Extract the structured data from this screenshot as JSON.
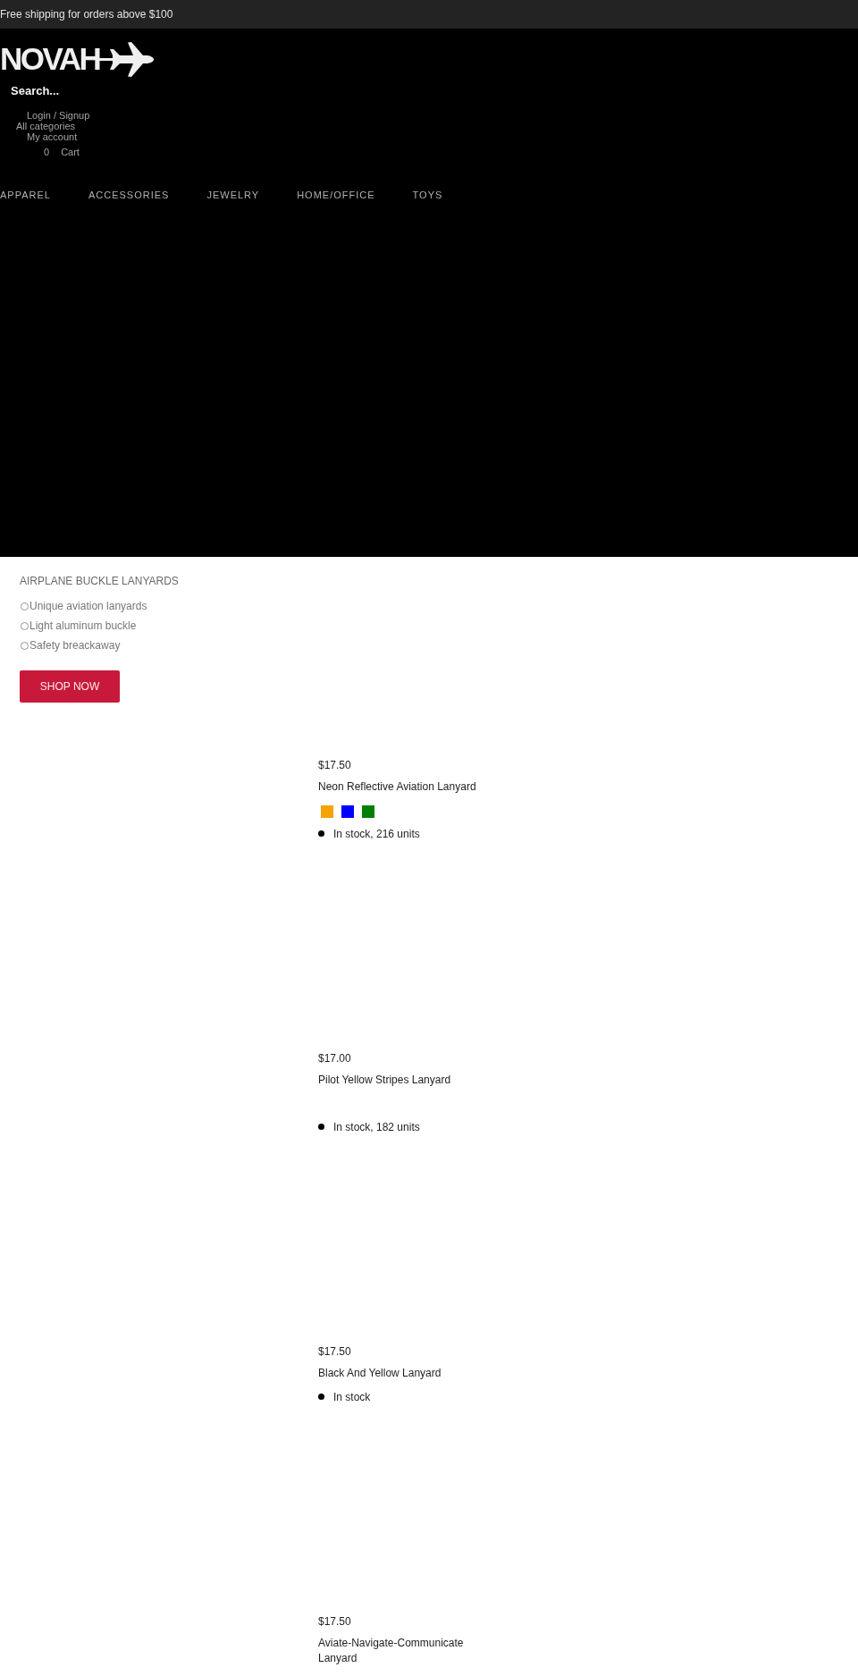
{
  "announcement": {
    "text": "Free shipping for orders above $100"
  },
  "header": {
    "logo": "NOVAH",
    "search": {
      "placeholder": "Search..."
    },
    "login": "Login / Signup",
    "categories": "All categories",
    "account": "My account",
    "cart": {
      "count": "0",
      "label": "Cart"
    }
  },
  "nav": [
    "APPAREL",
    "ACCESSORIES",
    "JEWELRY",
    "HOME/OFFICE",
    "TOYS"
  ],
  "hero": {
    "title": "AIRPLANE BUCKLE LANYARDS",
    "features": [
      "Unique aviation lanyards",
      "Light aluminum buckle",
      "Safety breackaway"
    ],
    "button": "SHOP NOW"
  },
  "products": [
    {
      "kind": "options",
      "price": "$17.50",
      "name": "Neon Reflective Aviation Lanyard",
      "swatches": [
        {
          "color": "#f5a300"
        },
        {
          "color": "#0000ff"
        },
        {
          "color": "#008000"
        }
      ],
      "stock": "In stock, 216 units"
    },
    {
      "kind": "options",
      "price": "$17.00",
      "name": "Pilot Yellow Stripes Lanyard",
      "stock": "In stock, 182 units"
    },
    {
      "kind": "plain",
      "price": "$17.50",
      "name": "Black And Yellow Lanyard",
      "stock": "In stock"
    },
    {
      "kind": "plain",
      "price": "$17.50",
      "name": "Aviate-Navigate-Communicate Lanyard"
    }
  ]
}
